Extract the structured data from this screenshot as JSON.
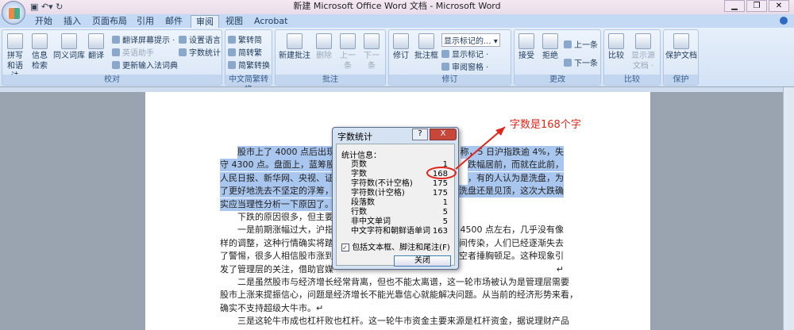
{
  "window": {
    "title": "新建 Microsoft Office Word 文档 - Microsoft Word"
  },
  "tabs": [
    "开始",
    "插入",
    "页面布局",
    "引用",
    "邮件",
    "审阅",
    "视图",
    "Acrobat"
  ],
  "ribbon": {
    "proofing": {
      "label": "校对",
      "spelling": "拼写和语法",
      "research": "信息检索",
      "thesaurus": "同义词库",
      "translate": "翻译",
      "translate_tip": "翻译屏幕提示 ·",
      "english_assist": "英语助手",
      "update_ime": "更新输入法词典",
      "set_language": "设置语言",
      "word_count": "字数统计"
    },
    "chinese": {
      "label": "中文简繁转换",
      "to_simplified": "繁转简",
      "to_traditional": "简转繁",
      "convert": "简繁转换"
    },
    "comments": {
      "label": "批注",
      "new": "新建批注",
      "delete": "删除",
      "prev": "上一条",
      "next": "下一条"
    },
    "tracking": {
      "label": "修订",
      "track": "修订",
      "balloons": "批注框",
      "display_select": "显示标记的...",
      "show_markup": "显示标记 ·",
      "review_pane": "审阅窗格 ·"
    },
    "changes": {
      "label": "更改",
      "accept": "接受",
      "reject": "拒绝",
      "prev": "上一条",
      "next": "下一条"
    },
    "compare": {
      "label": "比较",
      "compare": "比较",
      "show_source": "显示源文档 ·"
    },
    "protect": {
      "label": "保护",
      "protect_doc": "保护文档"
    }
  },
  "document": {
    "lines": [
      [
        "股市上了 4000 点后出现",
        "称，5 日沪指跌逾 4%，失"
      ],
      [
        "守 4300 点。盘面上，蓝筹股务",
        "跌幅居前，而就在此前，"
      ],
      [
        "人民日报、新华网、央视、证",
        "，有的人认为是洗盘，为"
      ],
      [
        "了更好地洗去不坚定的浮筹，",
        "洗盘还是见顶，这次大跌确"
      ],
      [
        "实应当理性分析一下原因了。",
        ""
      ],
      [
        "下跌的原因很多，但主要",
        ""
      ],
      [
        "一是前期涨幅过大，沪指",
        "4500 点左右，几乎没有像"
      ],
      [
        "样的调整，这种行情确实将踏",
        "间传染，人们已经逐渐失去"
      ],
      [
        "了警惕，很多人相信股市涨到",
        "空者捶胸顿足。这种现象引"
      ],
      [
        "发了管理层的关注，借助官媒",
        "↵"
      ],
      [
        "二是虽然股市与经济增长经常背离，但也不能太离谱，这一轮市场被认为是管理层需要",
        ""
      ],
      [
        "股市上涨来提振信心，问题是经济增长不能光靠信心就能解决问题。从当前的经济形势来看，",
        ""
      ],
      [
        "确实不支持超级大牛市。↵",
        ""
      ],
      [
        "三是这轮牛市成也杠杆败也杠杆。这一轮牛市资金主要来源是杠杆资金，据说理财产品",
        ""
      ]
    ]
  },
  "dialog": {
    "title": "字数统计",
    "help": "?",
    "close_x": "X",
    "section": "统计信息：",
    "stats": [
      {
        "label": "页数",
        "value": "1"
      },
      {
        "label": "字数",
        "value": "168"
      },
      {
        "label": "字符数(不计空格)",
        "value": "175"
      },
      {
        "label": "字符数(计空格)",
        "value": "175"
      },
      {
        "label": "段落数",
        "value": "1"
      },
      {
        "label": "行数",
        "value": "5"
      },
      {
        "label": "非中文单词",
        "value": "5"
      },
      {
        "label": "中文字符和朝鲜语单词",
        "value": "163"
      }
    ],
    "checkbox": "包括文本框、脚注和尾注(F)",
    "close_button": "关闭"
  },
  "annotation": {
    "text": "字数是168个字",
    "color": "#e0261c"
  }
}
